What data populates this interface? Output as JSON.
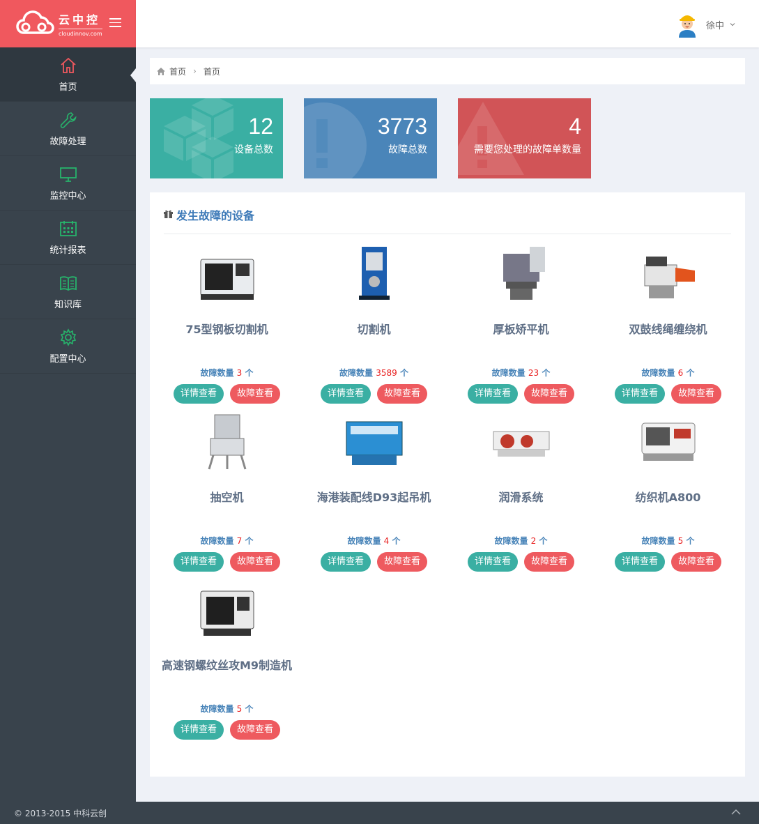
{
  "brand": {
    "name": "云中控",
    "domain": "cloudinnov.com"
  },
  "sidebar": {
    "items": [
      {
        "label": "首页",
        "icon": "home-icon",
        "active": true
      },
      {
        "label": "故障处理",
        "icon": "wrench-icon"
      },
      {
        "label": "监控中心",
        "icon": "monitor-icon"
      },
      {
        "label": "统计报表",
        "icon": "calendar-icon"
      },
      {
        "label": "知识库",
        "icon": "book-icon"
      },
      {
        "label": "配置中心",
        "icon": "gear-icon"
      }
    ]
  },
  "header": {
    "user_name": "徐中"
  },
  "breadcrumb": [
    "首页",
    "首页"
  ],
  "stats": [
    {
      "value": "12",
      "label": "设备总数",
      "color": "#3aafa3"
    },
    {
      "value": "3773",
      "label": "故障总数",
      "color": "#4a85b9"
    },
    {
      "value": "4",
      "label": "需要您处理的故障单数量",
      "color": "#d15457"
    }
  ],
  "panel": {
    "title": "发生故障的设备"
  },
  "count_prefix": "故障数量",
  "count_suffix": "个",
  "btn_detail": "详情查看",
  "btn_fault": "故障查看",
  "devices": [
    {
      "name": "75型钢板切割机",
      "count": "3"
    },
    {
      "name": "切割机",
      "count": "3589"
    },
    {
      "name": "厚板矫平机",
      "count": "23"
    },
    {
      "name": "双鼓线绳缠绕机",
      "count": "6"
    },
    {
      "name": "抽空机",
      "count": "7"
    },
    {
      "name": "海港装配线D93起吊机",
      "count": "4"
    },
    {
      "name": "润滑系统",
      "count": "2"
    },
    {
      "name": "纺织机A800",
      "count": "5"
    },
    {
      "name": "高速钢螺纹丝攻M9制造机",
      "count": "5"
    }
  ],
  "footer": {
    "text": "© 2013-2015 中科云创"
  }
}
